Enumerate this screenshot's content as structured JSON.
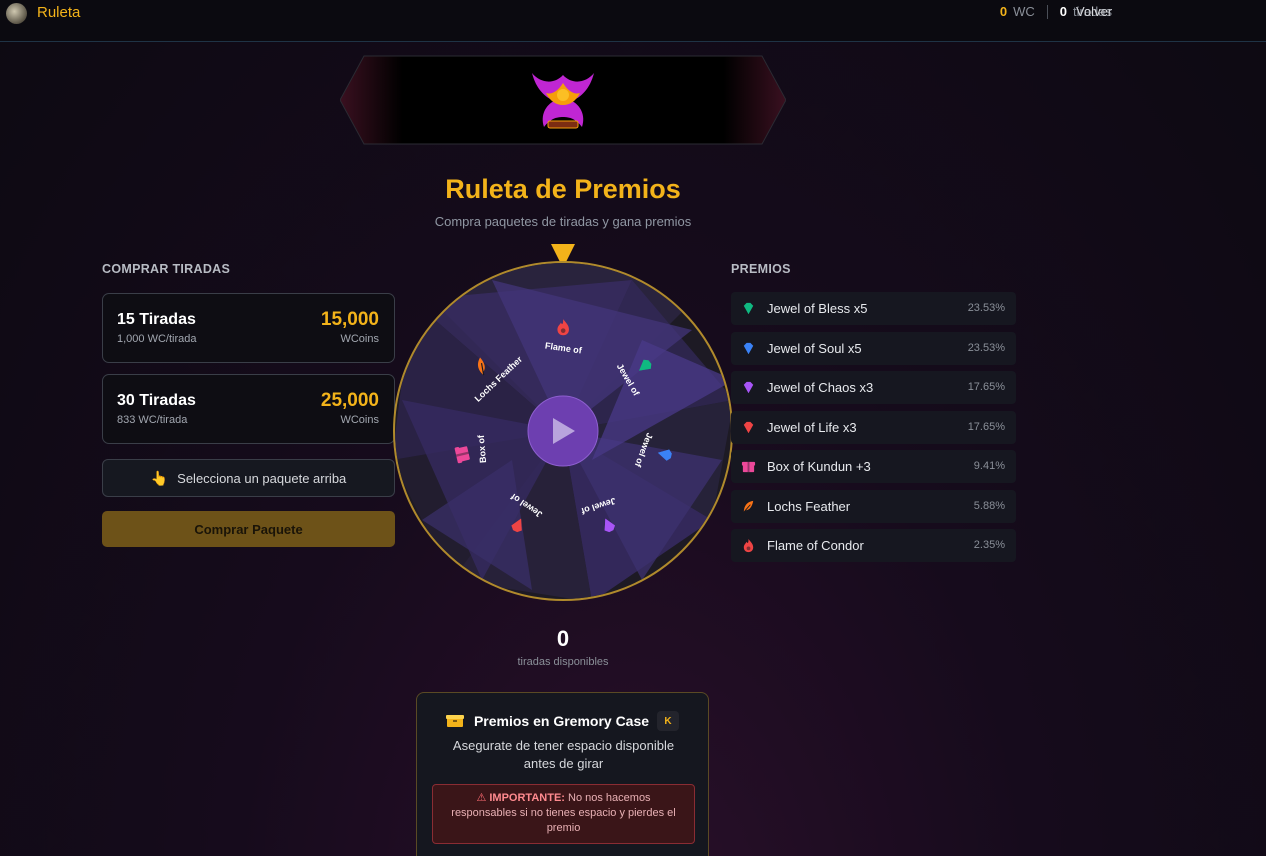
{
  "topbar": {
    "title": "Ruleta",
    "wc_value": "0",
    "wc_label": "WC",
    "spins_value": "0",
    "spins_label": "tiradas",
    "back_label": "Volver"
  },
  "header": {
    "title": "Ruleta de Premios",
    "subtitle": "Compra paquetes de tiradas y gana premios"
  },
  "buy": {
    "section_label": "COMPRAR TIRADAS",
    "packages": [
      {
        "name": "15 Tiradas",
        "rate": "1,000 WC/tirada",
        "price": "15,000",
        "currency": "WCoins"
      },
      {
        "name": "30 Tiradas",
        "rate": "833 WC/tirada",
        "price": "25,000",
        "currency": "WCoins"
      }
    ],
    "select_hint": "Selecciona un paquete arriba",
    "buy_button": "Comprar Paquete"
  },
  "wheel": {
    "segments": [
      {
        "label": "Flame of",
        "icon": "flame-icon",
        "color": "#ef4444"
      },
      {
        "label": "Jewel of",
        "icon": "gem-icon",
        "color": "#10b981"
      },
      {
        "label": "Jewel of",
        "icon": "gem-icon",
        "color": "#3b82f6"
      },
      {
        "label": "Jewel of",
        "icon": "gem-icon",
        "color": "#a855f7"
      },
      {
        "label": "Jewel of",
        "icon": "gem-icon",
        "color": "#ef4444"
      },
      {
        "label": "Box of",
        "icon": "gift-box-icon",
        "color": "#ec4899"
      },
      {
        "label": "Lochs Feather",
        "icon": "feather-icon",
        "color": "#f97316"
      }
    ]
  },
  "spins": {
    "count": "0",
    "label": "tiradas disponibles"
  },
  "prizes": {
    "section_label": "PREMIOS",
    "items": [
      {
        "name": "Jewel of Bless x5",
        "pct": "23.53%",
        "icon": "gem-icon",
        "color": "#10b981"
      },
      {
        "name": "Jewel of Soul x5",
        "pct": "23.53%",
        "icon": "gem-icon",
        "color": "#3b82f6"
      },
      {
        "name": "Jewel of Chaos x3",
        "pct": "17.65%",
        "icon": "gem-icon",
        "color": "#a855f7"
      },
      {
        "name": "Jewel of Life x3",
        "pct": "17.65%",
        "icon": "gem-icon",
        "color": "#ef4444"
      },
      {
        "name": "Box of Kundun +3",
        "pct": "9.41%",
        "icon": "gift-box-icon",
        "color": "#ec4899"
      },
      {
        "name": "Lochs Feather",
        "pct": "5.88%",
        "icon": "feather-icon",
        "color": "#f97316"
      },
      {
        "name": "Flame of Condor",
        "pct": "2.35%",
        "icon": "flame-icon",
        "color": "#ef4444"
      }
    ]
  },
  "info": {
    "title": "Premios en Gremory Case",
    "badge": "K",
    "description": "Asegurate de tener espacio disponible antes de girar",
    "warning_title": "IMPORTANTE:",
    "warning_text": "No nos hacemos responsables si no tienes espacio y pierdes el premio"
  }
}
